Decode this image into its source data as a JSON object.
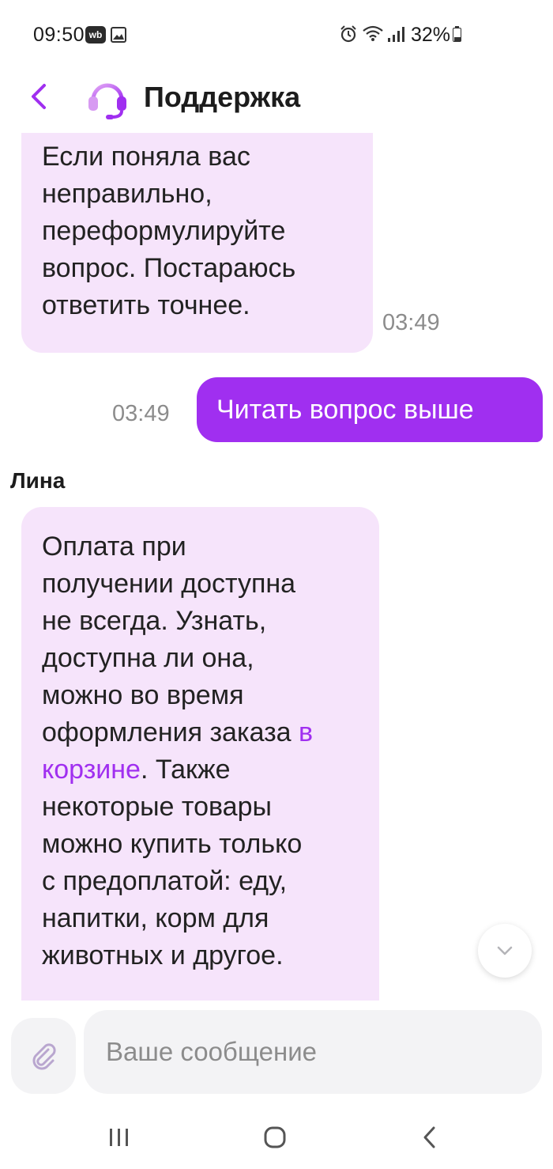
{
  "status_bar": {
    "time": "09:50",
    "badge": "wb",
    "battery": "32%",
    "icons": [
      "wb-badge-icon",
      "gallery-icon",
      "alarm-icon",
      "wifi-icon",
      "signal-icon",
      "battery-icon"
    ]
  },
  "header": {
    "title": "Поддержка",
    "back_icon": "chevron-left-icon",
    "avatar_icon": "headset-icon"
  },
  "messages": [
    {
      "direction": "incoming",
      "lines": [
        "Если поняла вас",
        "неправильно,",
        "переформулируйте",
        "вопрос. Постараюсь",
        "ответить точнее."
      ],
      "time": "03:49"
    },
    {
      "direction": "outgoing",
      "text": "Читать вопрос выше",
      "time": "03:49"
    },
    {
      "direction": "incoming",
      "sender": "Лина",
      "line_1": "Оплата при",
      "line_2": "получении доступна",
      "line_3": "не всегда. Узнать,",
      "line_4": "доступна ли она,",
      "line_5": "можно во время",
      "line_6_text": "оформления заказа ",
      "link_part1": "в",
      "link_part2": "корзине",
      "line_7_rest": ". Также",
      "line_8": "некоторые товары",
      "line_9": "можно купить только",
      "line_10": "с предоплатой: еду,",
      "line_11": "напитки, корм для",
      "line_12": "животных и другое."
    }
  ],
  "composer": {
    "placeholder": "Ваше сообщение",
    "value": "",
    "attach_icon": "paperclip-icon"
  },
  "colors": {
    "accent": "#a02ff0",
    "incoming_bubble": "#f6e4fb",
    "timestamp": "#8c8c8c",
    "input_bg": "#f3f3f5"
  }
}
